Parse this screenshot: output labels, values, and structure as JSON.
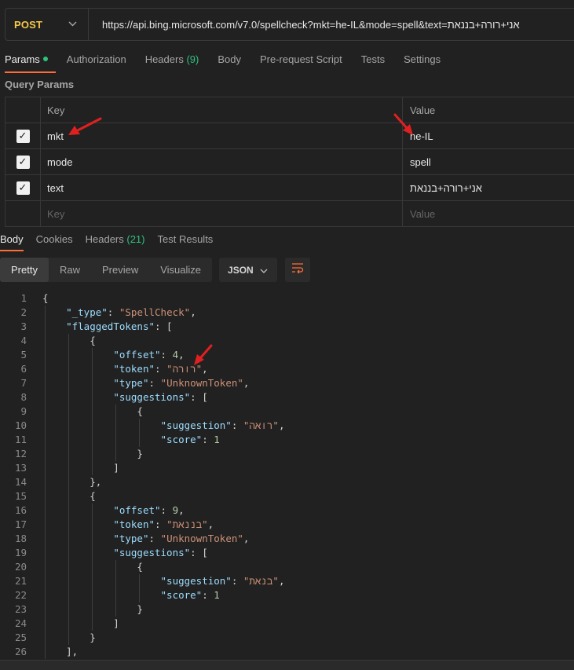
{
  "request": {
    "method": "POST",
    "url": "https://api.bing.microsoft.com/v7.0/spellcheck?mkt=he-IL&mode=spell&text=אני+רורה+בננאת"
  },
  "tabs": [
    {
      "label": "Params",
      "active": true,
      "dot": true
    },
    {
      "label": "Authorization"
    },
    {
      "label": "Headers",
      "count": "(9)"
    },
    {
      "label": "Body"
    },
    {
      "label": "Pre-request Script"
    },
    {
      "label": "Tests"
    },
    {
      "label": "Settings"
    }
  ],
  "query_params": {
    "title": "Query Params",
    "header_key": "Key",
    "header_value": "Value",
    "rows": [
      {
        "key": "mkt",
        "value": "he-IL",
        "checked": true
      },
      {
        "key": "mode",
        "value": "spell",
        "checked": true
      },
      {
        "key": "text",
        "value": "אני+רורה+בננאת",
        "checked": true
      }
    ],
    "placeholder_key": "Key",
    "placeholder_value": "Value"
  },
  "response_tabs": [
    {
      "label": "Body",
      "active": true
    },
    {
      "label": "Cookies"
    },
    {
      "label": "Headers",
      "count": "(21)"
    },
    {
      "label": "Test Results"
    }
  ],
  "view_modes": [
    "Pretty",
    "Raw",
    "Preview",
    "Visualize"
  ],
  "active_view": "Pretty",
  "format": "JSON",
  "icons": {
    "dropdown": "chevron-down-icon",
    "wrap": "wrap-lines-icon",
    "check": "checkmark-icon",
    "annotation": "red-arrow-icon"
  },
  "colors": {
    "method": "#f5c84a",
    "accent": "#ff6c37",
    "success": "#2ec27e",
    "arrow": "#e02020"
  },
  "code_lines": [
    {
      "n": "1",
      "t": "{"
    },
    {
      "n": "2",
      "t": "    \"_type\": \"SpellCheck\","
    },
    {
      "n": "3",
      "t": "    \"flaggedTokens\": ["
    },
    {
      "n": "4",
      "t": "        {"
    },
    {
      "n": "5",
      "t": "            \"offset\": 4,"
    },
    {
      "n": "6",
      "t": "            \"token\": \"רורה\","
    },
    {
      "n": "7",
      "t": "            \"type\": \"UnknownToken\","
    },
    {
      "n": "8",
      "t": "            \"suggestions\": ["
    },
    {
      "n": "9",
      "t": "                {"
    },
    {
      "n": "10",
      "t": "                    \"suggestion\": \"רואה\","
    },
    {
      "n": "11",
      "t": "                    \"score\": 1"
    },
    {
      "n": "12",
      "t": "                }"
    },
    {
      "n": "13",
      "t": "            ]"
    },
    {
      "n": "14",
      "t": "        },"
    },
    {
      "n": "15",
      "t": "        {"
    },
    {
      "n": "16",
      "t": "            \"offset\": 9,"
    },
    {
      "n": "17",
      "t": "            \"token\": \"בננאת\","
    },
    {
      "n": "18",
      "t": "            \"type\": \"UnknownToken\","
    },
    {
      "n": "19",
      "t": "            \"suggestions\": ["
    },
    {
      "n": "20",
      "t": "                {"
    },
    {
      "n": "21",
      "t": "                    \"suggestion\": \"בנאת\","
    },
    {
      "n": "22",
      "t": "                    \"score\": 1"
    },
    {
      "n": "23",
      "t": "                }"
    },
    {
      "n": "24",
      "t": "            ]"
    },
    {
      "n": "25",
      "t": "        }"
    },
    {
      "n": "26",
      "t": "    ],"
    }
  ]
}
